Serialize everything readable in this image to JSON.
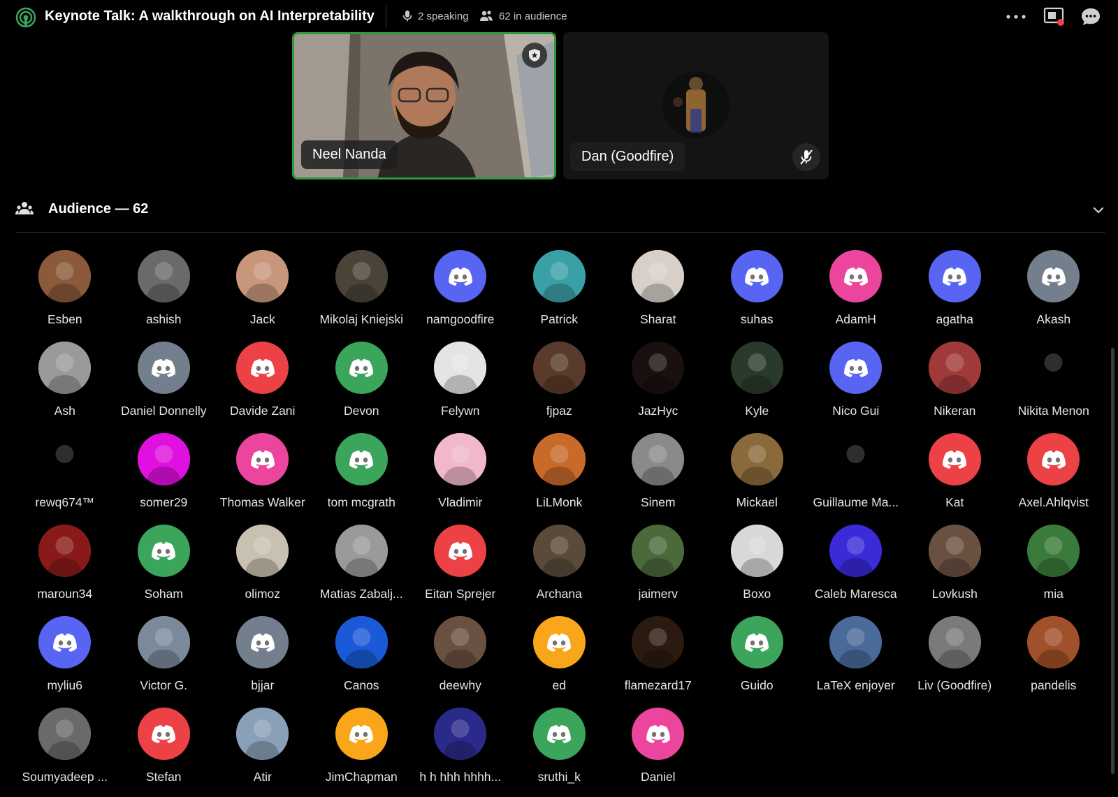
{
  "header": {
    "title": "Keynote Talk: A walkthrough on AI Interpretability",
    "speaking": "2 speaking",
    "audience": "62 in audience",
    "icons": [
      "stage-icon",
      "mic-icon",
      "people-icon",
      "more-icon",
      "screen-share-icon",
      "chat-icon"
    ]
  },
  "speakers": [
    {
      "name": "Neel Nanda",
      "active": true,
      "badge": "moderator-shield-icon"
    },
    {
      "name": "Dan (Goodfire)",
      "muted": true
    }
  ],
  "audience_header": {
    "title": "Audience — 62"
  },
  "colors": {
    "blurple": "#5865f2",
    "grey": "#747f8d",
    "red": "#ed4245",
    "green": "#3ba55c",
    "pink": "#eb459e",
    "orange": "#faa61a",
    "speaking_border": "#2a9a3c"
  },
  "audience": [
    {
      "name": "Esben",
      "color": "#8a5a3a",
      "avatar": "photo"
    },
    {
      "name": "ashish",
      "color": "#6a6a6a",
      "avatar": "photo"
    },
    {
      "name": "Jack",
      "color": "#c8967a",
      "avatar": "photo"
    },
    {
      "name": "Mikolaj Kniejski",
      "color": "#4a4438",
      "avatar": "photo"
    },
    {
      "name": "namgoodfire",
      "color": "#5865f2",
      "avatar": "discord"
    },
    {
      "name": "Patrick",
      "color": "#3aa0a8",
      "avatar": "photo"
    },
    {
      "name": "Sharat",
      "color": "#d8d0c8",
      "avatar": "photo"
    },
    {
      "name": "suhas",
      "color": "#5865f2",
      "avatar": "discord"
    },
    {
      "name": "AdamH",
      "color": "#eb459e",
      "avatar": "discord"
    },
    {
      "name": "agatha",
      "color": "#5865f2",
      "avatar": "discord"
    },
    {
      "name": "Akash",
      "color": "#747f8d",
      "avatar": "discord"
    },
    {
      "name": "Ash",
      "color": "#9a9a9a",
      "avatar": "photo"
    },
    {
      "name": "Daniel Donnelly",
      "color": "#747f8d",
      "avatar": "discord"
    },
    {
      "name": "Davide Zani",
      "color": "#ed4245",
      "avatar": "discord"
    },
    {
      "name": "Devon",
      "color": "#3ba55c",
      "avatar": "discord"
    },
    {
      "name": "Felywn",
      "color": "#e4e4e4",
      "avatar": "photo"
    },
    {
      "name": "fjpaz",
      "color": "#5a3a2a",
      "avatar": "photo"
    },
    {
      "name": "JazHyc",
      "color": "#1a1010",
      "avatar": "photo"
    },
    {
      "name": "Kyle",
      "color": "#2a3a2a",
      "avatar": "photo"
    },
    {
      "name": "Nico Gui",
      "color": "#5865f2",
      "avatar": "discord"
    },
    {
      "name": "Nikeran",
      "color": "#a03a3a",
      "avatar": "photo"
    },
    {
      "name": "Nikita Menon",
      "color": "#000000",
      "avatar": "photo"
    },
    {
      "name": "rewq674™",
      "color": "#000000",
      "avatar": "photo"
    },
    {
      "name": "somer29",
      "color": "#e010e0",
      "avatar": "photo"
    },
    {
      "name": "Thomas Walker",
      "color": "#eb459e",
      "avatar": "discord"
    },
    {
      "name": "tom mcgrath",
      "color": "#3ba55c",
      "avatar": "discord"
    },
    {
      "name": "Vladimir",
      "color": "#f0b8c8",
      "avatar": "photo"
    },
    {
      "name": "LiLMonk",
      "color": "#c86a2a",
      "avatar": "photo"
    },
    {
      "name": "Sinem",
      "color": "#8a8a8a",
      "avatar": "photo"
    },
    {
      "name": "Mickael",
      "color": "#8a6a3a",
      "avatar": "photo"
    },
    {
      "name": "Guillaume Ma...",
      "color": "#000000",
      "avatar": "photo"
    },
    {
      "name": "Kat",
      "color": "#ed4245",
      "avatar": "discord"
    },
    {
      "name": "Axel.Ahlqvist",
      "color": "#ed4245",
      "avatar": "discord"
    },
    {
      "name": "maroun34",
      "color": "#8a1a1a",
      "avatar": "photo"
    },
    {
      "name": "Soham",
      "color": "#3ba55c",
      "avatar": "discord"
    },
    {
      "name": "olimoz",
      "color": "#c8c0b0",
      "avatar": "photo"
    },
    {
      "name": "Matias Zabalj...",
      "color": "#9a9a9a",
      "avatar": "photo"
    },
    {
      "name": "Eitan Sprejer",
      "color": "#ed4245",
      "avatar": "discord"
    },
    {
      "name": "Archana",
      "color": "#5a4a3a",
      "avatar": "photo"
    },
    {
      "name": "jaimerv",
      "color": "#4a6a3a",
      "avatar": "photo"
    },
    {
      "name": "Boxo",
      "color": "#d8d8d8",
      "avatar": "photo"
    },
    {
      "name": "Caleb Maresca",
      "color": "#3a2ad8",
      "avatar": "photo"
    },
    {
      "name": "Lovkush",
      "color": "#6a5040",
      "avatar": "photo"
    },
    {
      "name": "mia",
      "color": "#3a7a3a",
      "avatar": "photo"
    },
    {
      "name": "myliu6",
      "color": "#5865f2",
      "avatar": "discord"
    },
    {
      "name": "Victor G.",
      "color": "#7a8a9a",
      "avatar": "photo"
    },
    {
      "name": "bjjar",
      "color": "#747f8d",
      "avatar": "discord"
    },
    {
      "name": "Canos",
      "color": "#1a5ad8",
      "avatar": "photo"
    },
    {
      "name": "deewhy",
      "color": "#6a5040",
      "avatar": "photo"
    },
    {
      "name": "ed",
      "color": "#faa61a",
      "avatar": "discord"
    },
    {
      "name": "flamezard17",
      "color": "#2a1a10",
      "avatar": "photo"
    },
    {
      "name": "Guido",
      "color": "#3ba55c",
      "avatar": "discord"
    },
    {
      "name": "LaTeX enjoyer",
      "color": "#4a6a9a",
      "avatar": "photo"
    },
    {
      "name": "Liv (Goodfire)",
      "color": "#7a7a7a",
      "avatar": "photo"
    },
    {
      "name": "pandelis",
      "color": "#a0502a",
      "avatar": "photo"
    },
    {
      "name": "Soumyadeep ...",
      "color": "#6a6a6a",
      "avatar": "photo"
    },
    {
      "name": "Stefan",
      "color": "#ed4245",
      "avatar": "discord"
    },
    {
      "name": "Atir",
      "color": "#8aa0b8",
      "avatar": "photo"
    },
    {
      "name": "JimChapman",
      "color": "#faa61a",
      "avatar": "discord"
    },
    {
      "name": "h h hhh hhhh...",
      "color": "#2a2a8a",
      "avatar": "photo"
    },
    {
      "name": "sruthi_k",
      "color": "#3ba55c",
      "avatar": "discord"
    },
    {
      "name": "Daniel",
      "color": "#eb459e",
      "avatar": "discord"
    }
  ]
}
